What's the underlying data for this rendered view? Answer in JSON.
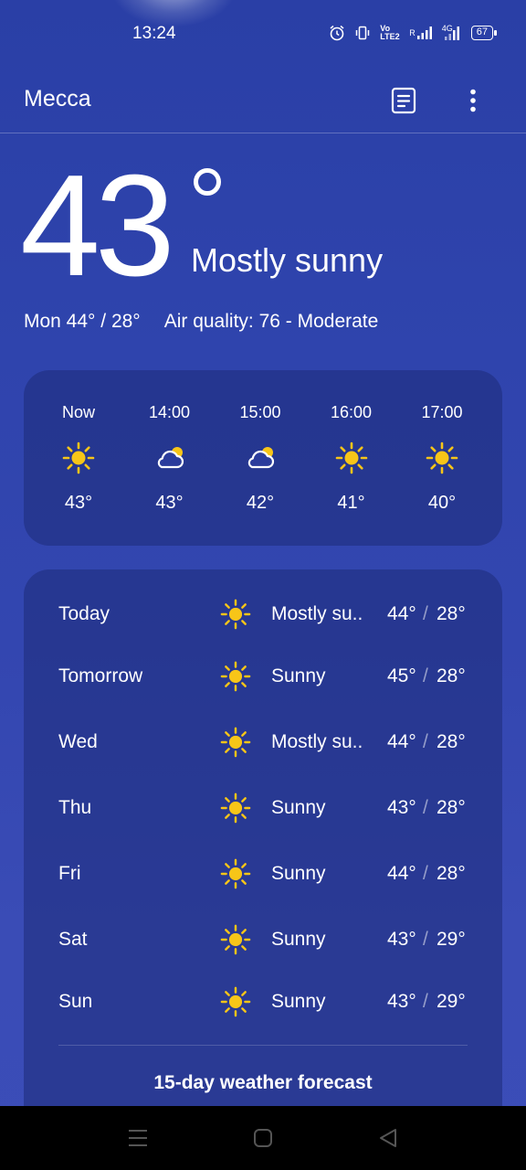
{
  "status_bar": {
    "time": "13:24",
    "volte": "Vo LTE2",
    "roaming": "R",
    "network": "4G",
    "battery": "67",
    "icons": [
      "alarm-icon",
      "vibrate-icon",
      "volte-icon",
      "signal-icon",
      "signal-4g-icon",
      "battery-icon"
    ]
  },
  "app_bar": {
    "city": "Mecca",
    "icons": [
      "list-icon",
      "more-vert-icon"
    ]
  },
  "current": {
    "temperature": "43",
    "condition": "Mostly sunny",
    "day_range": "Mon 44° / 28°",
    "air_quality": "Air quality: 76 - Moderate"
  },
  "hourly": [
    {
      "time": "Now",
      "icon": "sun-icon",
      "temp": "43°"
    },
    {
      "time": "14:00",
      "icon": "partly-cloudy-icon",
      "temp": "43°"
    },
    {
      "time": "15:00",
      "icon": "partly-cloudy-icon",
      "temp": "42°"
    },
    {
      "time": "16:00",
      "icon": "sun-icon",
      "temp": "41°"
    },
    {
      "time": "17:00",
      "icon": "sun-icon",
      "temp": "40°"
    }
  ],
  "daily": [
    {
      "day": "Today",
      "icon": "sun-icon",
      "condition": "Mostly su..",
      "high": "44°",
      "low": "28°"
    },
    {
      "day": "Tomorrow",
      "icon": "sun-icon",
      "condition": "Sunny",
      "high": "45°",
      "low": "28°"
    },
    {
      "day": "Wed",
      "icon": "sun-icon",
      "condition": "Mostly su..",
      "high": "44°",
      "low": "28°"
    },
    {
      "day": "Thu",
      "icon": "sun-icon",
      "condition": "Sunny",
      "high": "43°",
      "low": "28°"
    },
    {
      "day": "Fri",
      "icon": "sun-icon",
      "condition": "Sunny",
      "high": "44°",
      "low": "28°"
    },
    {
      "day": "Sat",
      "icon": "sun-icon",
      "condition": "Sunny",
      "high": "43°",
      "low": "29°"
    },
    {
      "day": "Sun",
      "icon": "sun-icon",
      "condition": "Sunny",
      "high": "43°",
      "low": "29°"
    }
  ],
  "range_separator": "/",
  "forecast_link": "15-day weather forecast",
  "colors": {
    "background": "#2f44ad",
    "card": "#24348a",
    "sun": "#f7c518",
    "text": "#ffffff"
  },
  "nav_bar": {
    "icons": [
      "menu-icon",
      "home-icon",
      "back-icon"
    ]
  }
}
